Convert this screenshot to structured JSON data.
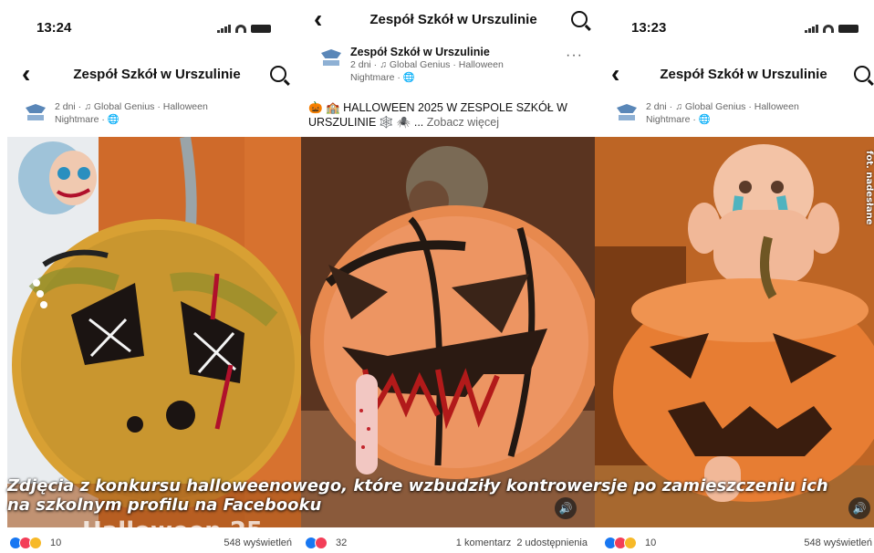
{
  "panel1": {
    "time": "13:24",
    "header_title": "Zespół Szkół w Urszulinie",
    "meta_line1": "2 dni · ♫ Global Genius · Halloween",
    "meta_line2": "Nightmare · 🌐",
    "reaction_count": "10",
    "views": "548 wyświetleń"
  },
  "panel2": {
    "header_title": "Zespół Szkół w Urszulinie",
    "page_name": "Zespół Szkół w Urszulinie",
    "meta_line1": "2 dni · ♫ Global Genius · Halloween",
    "meta_line2": "Nightmare · 🌐",
    "more_dots": "···",
    "post_text": "🎃 🏫 HALLOWEEN 2025  W ZESPOLE SZKÓŁ W URSZULINIE 🕸️ 🕷️ ...",
    "see_more": "Zobacz więcej",
    "overlay_text": "Halloween 25",
    "reaction_count": "32",
    "comments": "1 komentarz",
    "shares": "2 udostępnienia"
  },
  "panel3": {
    "time": "13:23",
    "header_title": "Zespół Szkół w Urszulinie",
    "meta_line1": "2 dni · ♫ Global Genius · Halloween",
    "meta_line2": "Nightmare · 🌐",
    "reaction_count": "10",
    "views": "548 wyświetleń"
  },
  "caption": "Zdjęcia z konkursu halloweenowego, które wzbudziły kontrowersje po zamieszczeniu ich na szkolnym profilu na Facebooku",
  "photo_credit": "fot. nadesłane",
  "icons": {
    "back": "chevron-left-icon",
    "search": "search-icon",
    "volume": "volume-icon",
    "globe": "globe-icon",
    "music": "music-note-icon"
  },
  "colors": {
    "like": "#1877f2",
    "love": "#f33e58",
    "haha": "#f7b928",
    "pumpkin": "#e07a2c"
  }
}
